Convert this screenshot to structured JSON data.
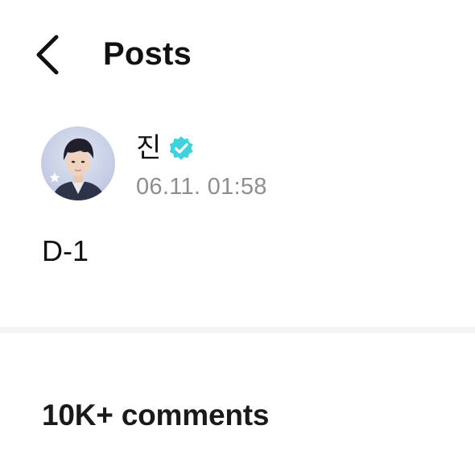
{
  "header": {
    "back_icon": "chevron-left-icon",
    "title": "Posts"
  },
  "post": {
    "author": {
      "name": "진",
      "verified": true,
      "verified_icon": "verified-check-icon",
      "verified_color": "#3ed3dc",
      "avatar_icon": "avatar-photo"
    },
    "timestamp": "06.11. 01:58",
    "body": "D-1"
  },
  "comments": {
    "count_label": "10K+ comments"
  },
  "colors": {
    "text_primary": "#111111",
    "text_secondary": "#8e8e8e",
    "divider": "#f4f4f4",
    "accent": "#3ed3dc"
  }
}
